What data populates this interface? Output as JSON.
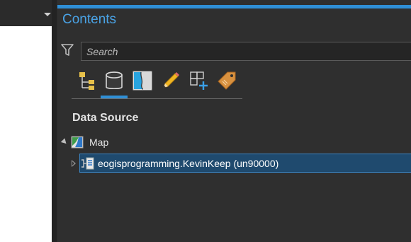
{
  "contents_pane": {
    "title": "Contents",
    "search": {
      "placeholder": "Search",
      "value": ""
    },
    "toolbar": {
      "active_tab": "list-by-data-source",
      "tools": [
        {
          "name": "list-by-drawing-order",
          "icon": "drawing-order-icon"
        },
        {
          "name": "list-by-data-source",
          "icon": "database-icon"
        },
        {
          "name": "list-by-selection",
          "icon": "selection-map-icon"
        },
        {
          "name": "list-by-editing",
          "icon": "pencil-icon"
        },
        {
          "name": "list-by-snapping",
          "icon": "snapping-icon"
        },
        {
          "name": "list-by-labeling",
          "icon": "label-tag-icon"
        }
      ]
    },
    "section_title": "Data Source",
    "tree": {
      "map": {
        "label": "Map",
        "expanded": true,
        "icon": "map-icon"
      },
      "datasource": {
        "label": "eogisprogramming.KevinKeep (un90000)",
        "selected": true,
        "expanded": false,
        "icon": "database-connection-icon"
      }
    }
  },
  "colors": {
    "accent": "#2f8fd6",
    "title": "#4aa3e6",
    "selection_bg": "#1f4a6e",
    "selection_border": "#3a84c2",
    "pane_bg": "#2f2f2f"
  }
}
